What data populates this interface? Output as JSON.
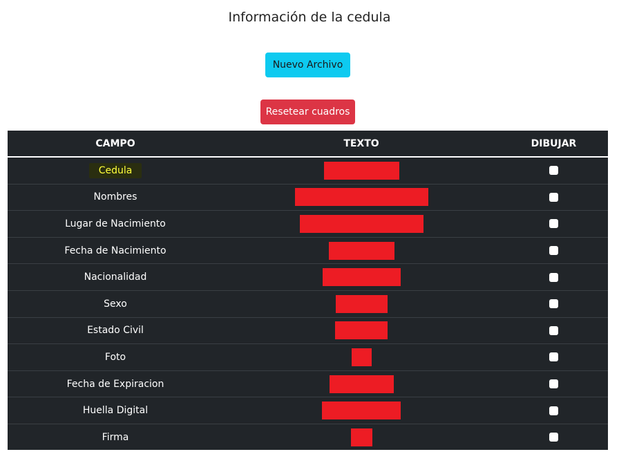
{
  "page": {
    "title": "Información de la cedula"
  },
  "buttons": {
    "new_file": "Nuevo Archivo",
    "reset": "Resetear cuadros"
  },
  "table": {
    "headers": [
      "CAMPO",
      "TEXTO",
      "DIBUJAR"
    ],
    "rows": [
      {
        "campo": "Cedula",
        "highlighted": true
      },
      {
        "campo": "Nombres"
      },
      {
        "campo": "Lugar de Nacimiento"
      },
      {
        "campo": "Fecha de Nacimiento"
      },
      {
        "campo": "Nacionalidad"
      },
      {
        "campo": "Sexo"
      },
      {
        "campo": "Estado Civil"
      },
      {
        "campo": "Foto"
      },
      {
        "campo": "Fecha de Expiracion"
      },
      {
        "campo": "Huella Digital"
      },
      {
        "campo": "Firma"
      }
    ]
  },
  "colors": {
    "info_button": "#0dcaf0",
    "danger_button": "#dc3545",
    "table_dark": "#212529",
    "redaction": "#ed1c24",
    "highlight_text": "#ffff3a"
  }
}
